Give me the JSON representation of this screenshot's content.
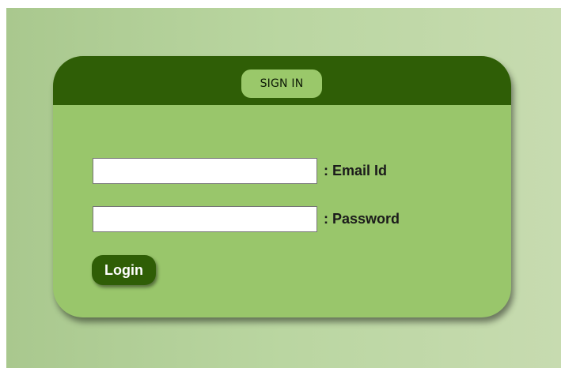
{
  "colors": {
    "header": "#2f5e06",
    "card": "#99c66b",
    "title_pill": "#9ac86a",
    "button": "#2f5e06",
    "button_text": "#ffffff",
    "page_background": "#bad6a1"
  },
  "card": {
    "title": "SIGN IN"
  },
  "form": {
    "email": {
      "label": ": Email Id",
      "value": "",
      "placeholder": ""
    },
    "password": {
      "label": ": Password",
      "value": "",
      "placeholder": ""
    },
    "login_label": "Login"
  }
}
